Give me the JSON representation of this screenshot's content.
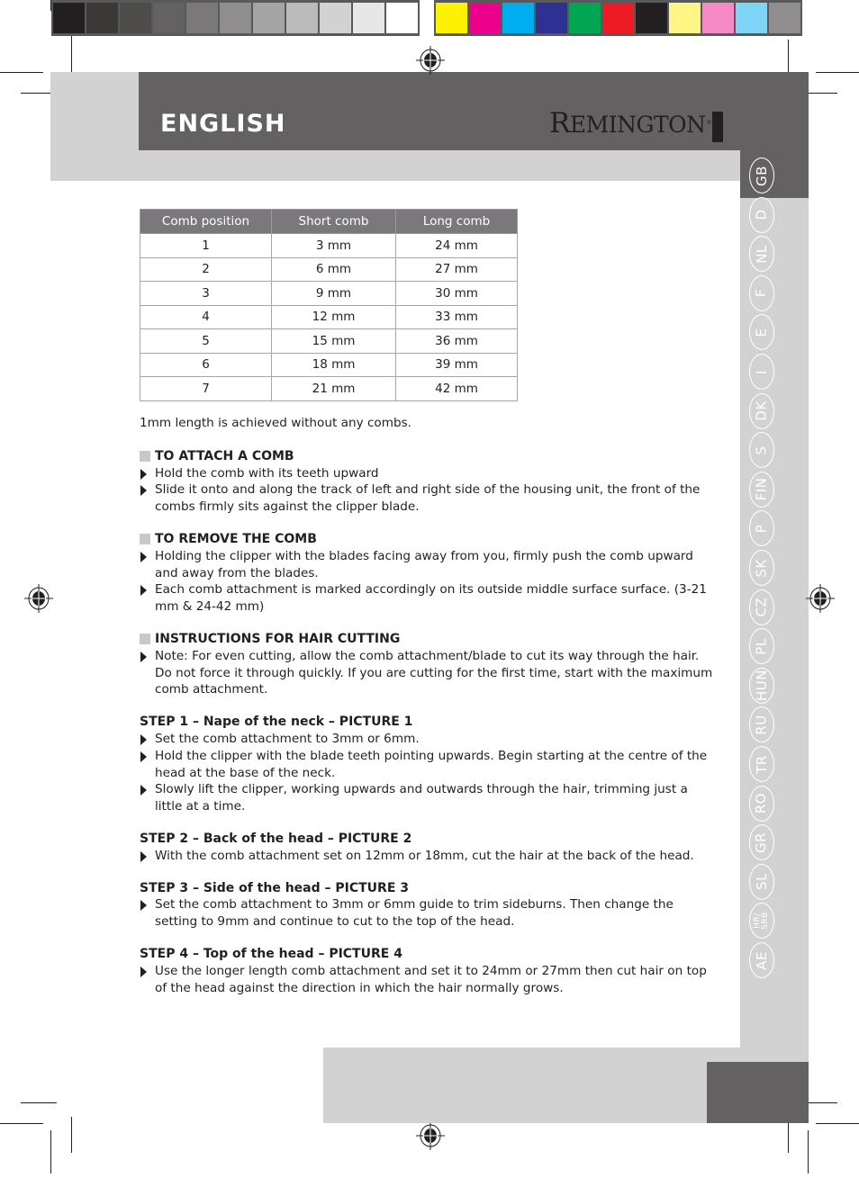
{
  "print_marks": {
    "gray_swatches": [
      "#231f20",
      "#3b3838",
      "#4e4c4a",
      "#636162",
      "#7a7879",
      "#8f8d8e",
      "#a5a4a4",
      "#bbbaba",
      "#d2d2d2",
      "#e7e7e7",
      "#ffffff"
    ],
    "color_swatches": [
      "#fff200",
      "#ec008c",
      "#00aeef",
      "#2e3192",
      "#00a651",
      "#ed1c24",
      "#231f20",
      "#fff685",
      "#f58ac7",
      "#7fd5f7",
      "#8f8d8e"
    ]
  },
  "header": {
    "title": "ENGLISH",
    "brand_initial": "R",
    "brand_rest": "EMINGTON",
    "brand_mark": "®"
  },
  "languages": [
    {
      "code": "GB",
      "active": true
    },
    {
      "code": "D"
    },
    {
      "code": "NL"
    },
    {
      "code": "F"
    },
    {
      "code": "E"
    },
    {
      "code": "I"
    },
    {
      "code": "DK"
    },
    {
      "code": "S"
    },
    {
      "code": "FIN"
    },
    {
      "code": "P"
    },
    {
      "code": "SK"
    },
    {
      "code": "CZ"
    },
    {
      "code": "PL"
    },
    {
      "code": "HUN"
    },
    {
      "code": "RU"
    },
    {
      "code": "TR"
    },
    {
      "code": "RO"
    },
    {
      "code": "GR"
    },
    {
      "code": "SL"
    },
    {
      "code": "HR/\nSRB"
    },
    {
      "code": "AE"
    }
  ],
  "comb_table": {
    "headers": [
      "Comb position",
      "Short comb",
      "Long comb"
    ],
    "rows": [
      [
        "1",
        "3 mm",
        "24 mm"
      ],
      [
        "2",
        "6 mm",
        "27 mm"
      ],
      [
        "3",
        "9 mm",
        "30 mm"
      ],
      [
        "4",
        "12 mm",
        "33 mm"
      ],
      [
        "5",
        "15 mm",
        "36 mm"
      ],
      [
        "6",
        "18 mm",
        "39 mm"
      ],
      [
        "7",
        "21 mm",
        "42 mm"
      ]
    ]
  },
  "content": {
    "intro": "1mm length is achieved without any combs.",
    "attach": {
      "title": "TO ATTACH A COMB",
      "bullets": [
        "Hold the comb with its teeth upward",
        "Slide it onto and along the track of left and right side of the housing unit, the front of the combs firmly sits against the clipper blade."
      ]
    },
    "remove": {
      "title": "TO REMOVE THE COMB",
      "bullets": [
        "Holding the clipper with the blades facing away from you, firmly push the comb upward and away from the blades.",
        "Each comb attachment is marked accordingly on its outside middle surface surface. (3-21 mm & 24-42 mm)"
      ]
    },
    "instructions": {
      "title": "INSTRUCTIONS FOR HAIR CUTTING",
      "bullets": [
        "Note: For even cutting, allow the comb attachment/blade to cut its way through the hair. Do not force it through quickly. If you are cutting for the first time, start with the maximum comb attachment."
      ]
    },
    "step1": {
      "title": "STEP 1 – Nape of the neck – PICTURE 1",
      "bullets": [
        "Set the comb attachment to 3mm or 6mm.",
        "Hold the clipper with the blade teeth pointing upwards. Begin starting at the centre of the head at the base of the neck.",
        "Slowly lift the clipper, working upwards and outwards through the hair, trimming just a little at a time."
      ]
    },
    "step2": {
      "title": "STEP 2 – Back of the head – PICTURE 2",
      "bullets": [
        "With the comb attachment set on 12mm or 18mm, cut the hair at the back of the head."
      ]
    },
    "step3": {
      "title": "STEP 3 – Side of the head – PICTURE 3",
      "bullets": [
        "Set the comb attachment to 3mm or 6mm guide to trim sideburns. Then change the setting to 9mm and continue to cut to the top of the head."
      ]
    },
    "step4": {
      "title": "STEP 4 – Top of the head – PICTURE 4",
      "bullets": [
        "Use the longer length comb attachment and set it to 24mm or 27mm then cut hair on top of the head against the direction in which the hair normally grows."
      ]
    }
  }
}
